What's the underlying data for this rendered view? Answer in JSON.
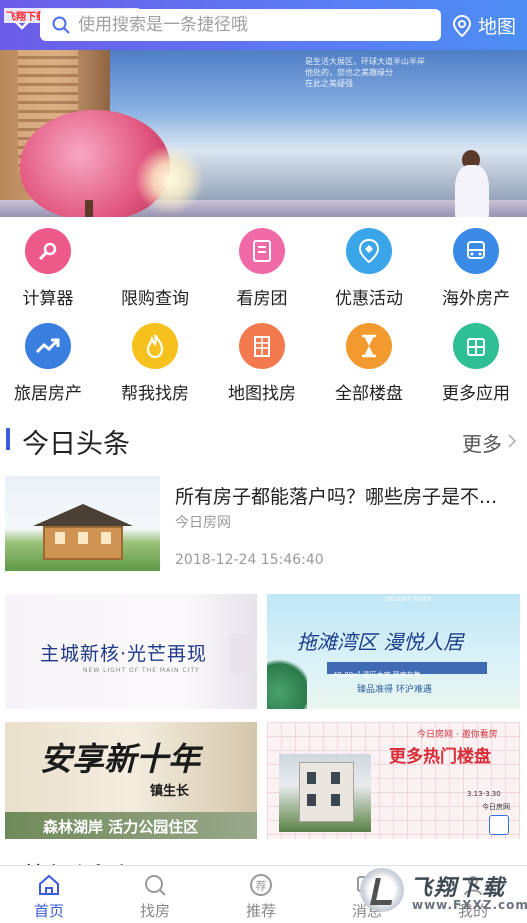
{
  "watermark_top": "飞翔下载 www.FXXZ.com",
  "search": {
    "placeholder": "使用搜索是一条捷径哦"
  },
  "map_button": {
    "label": "地图",
    "icon": "location-pin-icon"
  },
  "banner": {
    "slogan_line1": "是生活大展区，环球大道半山半岸",
    "slogan_line2": "他处的，您也之美趣缘分",
    "slogan_line3": "在此之美疑强",
    "dots_count": 3,
    "active_dot": 1
  },
  "grid": [
    {
      "label": "计算器",
      "icon": "calculator-icon",
      "color": "#ee5a8a"
    },
    {
      "label": "限购查询",
      "icon": "restriction-query-icon",
      "color": "#ffffff"
    },
    {
      "label": "看房团",
      "icon": "house-tour-icon",
      "color": "#f06aa8"
    },
    {
      "label": "优惠活动",
      "icon": "discount-icon",
      "color": "#3aa5e8"
    },
    {
      "label": "海外房产",
      "icon": "bus-icon",
      "color": "#3a8be8"
    },
    {
      "label": "旅居房产",
      "icon": "trend-up-icon",
      "color": "#3a7fe0"
    },
    {
      "label": "帮我找房",
      "icon": "flame-icon",
      "color": "#f6c11c"
    },
    {
      "label": "地图找房",
      "icon": "building-icon",
      "color": "#f27a4e"
    },
    {
      "label": "全部楼盘",
      "icon": "hourglass-icon",
      "color": "#f29a2e"
    },
    {
      "label": "更多应用",
      "icon": "apps-icon",
      "color": "#2fbf95"
    }
  ],
  "headline_section": {
    "title": "今日头条",
    "more": "更多"
  },
  "news": {
    "title": "所有房子都能落户吗？哪些房子是不...",
    "source": "今日房网",
    "time": "2018-12-24 15:46:40"
  },
  "ads": {
    "ad1": {
      "title": "主城新核·光芒再现",
      "subtitle": "NEW LIGHT OF THE MAIN CITY"
    },
    "ad2": {
      "brand": "DELIGHT RIVER",
      "title": "拖滩湾区 漫悦人居",
      "strip": "49-89㎡ 湾区大宅 现房在售",
      "sub": "臻品准得  环沪难遇"
    },
    "ad3": {
      "title": "安享新十年",
      "sub": "镇生长",
      "bottom": "森林湖岸  活力公园住区"
    },
    "ad4": {
      "top": "今日房网 · 邀你看房",
      "title": "更多热门楼盘",
      "date": "3.13-3.30",
      "src": "今日房网"
    }
  },
  "next_section": {
    "title": "热门活动"
  },
  "bottom_nav": [
    {
      "label": "首页",
      "icon": "home-icon",
      "active": true
    },
    {
      "label": "找房",
      "icon": "search-icon",
      "active": false
    },
    {
      "label": "推荐",
      "icon": "recommend-icon",
      "active": false
    },
    {
      "label": "消息",
      "icon": "message-icon",
      "active": false
    },
    {
      "label": "我的",
      "icon": "profile-icon",
      "active": false
    }
  ],
  "watermark_bottom": {
    "title": "飞翔下载",
    "url": "www.FXXZ.com"
  },
  "colors": {
    "accent": "#3b5bdb",
    "topbar_start": "#6c5ce7",
    "topbar_end": "#4c8ef2"
  }
}
